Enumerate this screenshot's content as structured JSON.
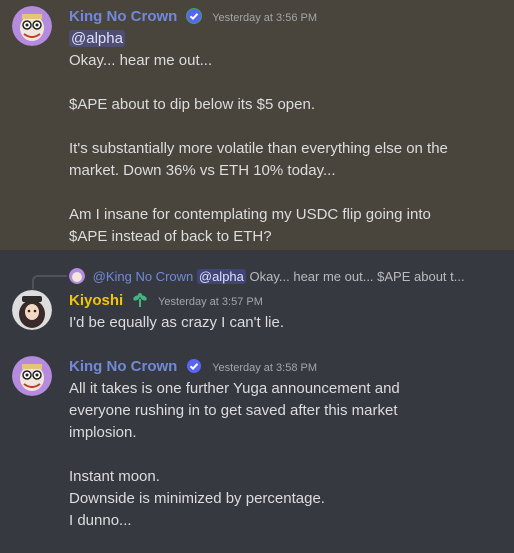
{
  "colors": {
    "background": "#36393f",
    "highlight": "#49443c",
    "username_blue": "#7289da",
    "username_gold": "#f1c40f"
  },
  "messages": [
    {
      "author": "King No Crown",
      "verified_icon": "verified-check-icon",
      "timestamp": "Yesterday at 3:56 PM",
      "mention": "@alpha",
      "lines": [
        "Okay... hear me out...",
        "$APE about to dip below its $5 open.",
        "It's substantially more volatile than everything else on the",
        "market. Down 36% vs ETH 10% today...",
        "Am I insane for contemplating my USDC flip going into",
        "$APE instead of back to ETH?"
      ]
    },
    {
      "reply": {
        "author": "@King No Crown",
        "mention": "@alpha",
        "preview": "Okay... hear me out...  $APE about t..."
      },
      "author": "Kiyoshi",
      "role_icon": "sprout-icon",
      "timestamp": "Yesterday at 3:57 PM",
      "lines": [
        "I'd be equally as crazy I can't lie."
      ]
    },
    {
      "author": "King No Crown",
      "verified_icon": "verified-check-icon",
      "timestamp": "Yesterday at 3:58 PM",
      "lines": [
        "All it takes is one further Yuga announcement and",
        "everyone rushing in to get saved after this market",
        "implosion.",
        "Instant moon.",
        "Downside is minimized by percentage.",
        "I dunno..."
      ]
    }
  ]
}
